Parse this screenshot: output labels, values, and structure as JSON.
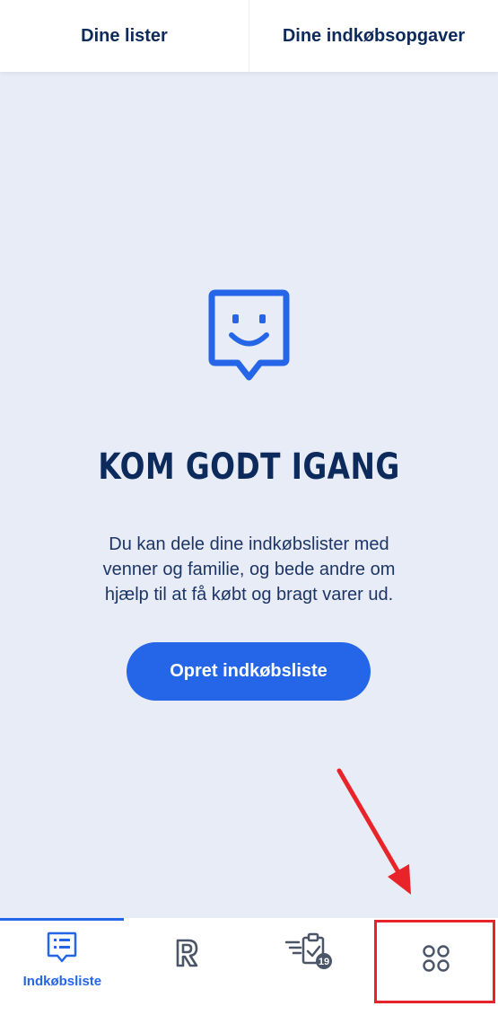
{
  "top_tabs": {
    "lists": "Dine lister",
    "tasks": "Dine indkøbsopgaver"
  },
  "hero": {
    "icon": "smiley-chat-icon",
    "title": "KOM GODT IGANG",
    "description": "Du kan dele dine indkøbslister med venner og familie, og bede andre om hjælp til at få købt og bragt varer ud.",
    "button_label": "Opret indkøbsliste"
  },
  "bottom_nav": {
    "items": [
      {
        "icon": "shopping-list-icon",
        "label": "Indkøbsliste",
        "active": true
      },
      {
        "icon": "r-logo-icon",
        "label": ""
      },
      {
        "icon": "tasks-clipboard-icon",
        "badge": "19"
      },
      {
        "icon": "more-apps-icon",
        "label": ""
      }
    ]
  },
  "colors": {
    "accent": "#2566e8",
    "text_dark": "#0d2a5c",
    "background": "#e8ecf6",
    "annotation": "#e8242a"
  }
}
